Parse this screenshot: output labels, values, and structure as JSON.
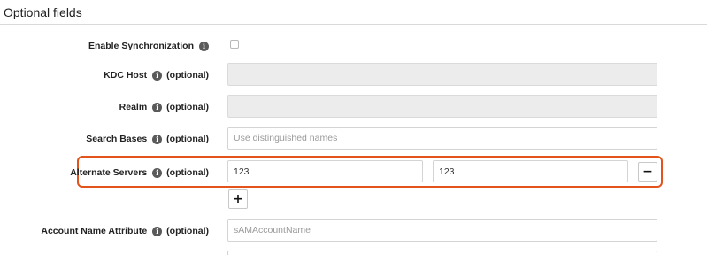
{
  "section": {
    "title": "Optional fields"
  },
  "optional_label": "(optional)",
  "fields": {
    "enable_sync": {
      "label": "Enable Synchronization",
      "checked": false
    },
    "kdc_host": {
      "label": "KDC Host",
      "value": ""
    },
    "realm": {
      "label": "Realm",
      "value": ""
    },
    "search_bases": {
      "label": "Search Bases",
      "placeholder": "Use distinguished names",
      "value": ""
    },
    "alternate_servers": {
      "label": "Alternate Servers",
      "value_1": "123",
      "value_2": "123",
      "remove_label": "−",
      "add_label": "+"
    },
    "account_name_attribute": {
      "label": "Account Name Attribute",
      "placeholder": "sAMAccountName",
      "value": ""
    }
  },
  "icons": {
    "info": "info-icon",
    "remove": "minus-icon",
    "add": "plus-icon"
  },
  "colors": {
    "highlight": "#e2541b",
    "disabled_bg": "#ececec"
  }
}
